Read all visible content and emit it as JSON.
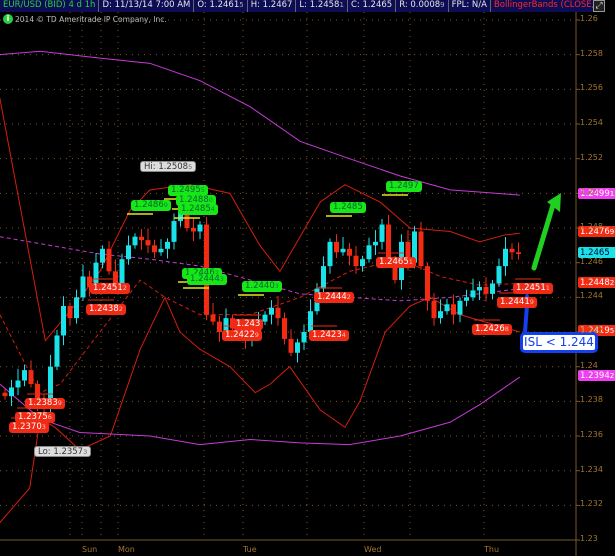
{
  "header": {
    "symbol": "EUR/USD (BID) 4 d 1h",
    "date": "D: 11/13/14 7:00 AM",
    "open": "O: 1.2461",
    "open_sub": "5",
    "high": "H: 1.2467",
    "low": "L: 1.2458",
    "low_sub": "1",
    "close": "C: 1.2465",
    "range": "R: 0.0008",
    "range_sub": "9",
    "fpl": "FPL: N/A",
    "study": "BollingerBands (CLOSE, 0,..."
  },
  "copyright": "2014 © TD Ameritrade IP Company, Inc.",
  "info_icon": "i",
  "expand_icon": "⤢",
  "colors": {
    "up": "#19e3e8",
    "down": "#f52a12",
    "band_red": "#d41e0e",
    "band_magenta": "#c63ad6",
    "grid": "#7a5a26"
  },
  "y_axis": {
    "min": 1.23,
    "max": 1.26,
    "ticks": [
      "1.26",
      "1.258",
      "1.256",
      "1.254",
      "1.252",
      "1.25",
      "1.248",
      "1.246",
      "1.244",
      "1.242",
      "1.24",
      "1.238",
      "1.236",
      "1.234",
      "1.232",
      "1.23"
    ]
  },
  "x_axis": {
    "days": [
      "Sun",
      "Mon",
      "Tue",
      "Wed",
      "Thu"
    ]
  },
  "chart_data": {
    "type": "candlestick",
    "closes": [
      1.2383,
      1.2388,
      1.2392,
      1.2398,
      1.239,
      1.238,
      1.2376,
      1.24,
      1.2418,
      1.2435,
      1.2428,
      1.244,
      1.2452,
      1.2446,
      1.246,
      1.2468,
      1.2455,
      1.2448,
      1.2462,
      1.247,
      1.2475,
      1.2473,
      1.247,
      1.2466,
      1.2468,
      1.2472,
      1.2484,
      1.2496,
      1.248,
      1.2478,
      1.2482,
      1.243,
      1.2426,
      1.242,
      1.2428,
      1.2422,
      1.2418,
      1.2416,
      1.242,
      1.2426,
      1.243,
      1.2434,
      1.2428,
      1.2416,
      1.2408,
      1.2414,
      1.242,
      1.2432,
      1.2445,
      1.2458,
      1.2472,
      1.2466,
      1.2468,
      1.2464,
      1.2458,
      1.2462,
      1.247,
      1.2472,
      1.2482,
      1.2462,
      1.245,
      1.2472,
      1.246,
      1.2478,
      1.2458,
      1.2438,
      1.2428,
      1.2432,
      1.2436,
      1.243,
      1.2438,
      1.244,
      1.2444,
      1.2446,
      1.2442,
      1.2448,
      1.2458,
      1.2468,
      1.2466,
      1.2465
    ],
    "bands": [
      {
        "name": "upper-red",
        "color": "#d41e0e",
        "dash": false,
        "points": [
          [
            -0.8,
            1.2555
          ],
          [
            6.2,
            1.2415
          ],
          [
            10,
            1.2432
          ],
          [
            14.6,
            1.2455
          ],
          [
            19.2,
            1.249
          ],
          [
            22.3,
            1.2502
          ],
          [
            28.5,
            1.2505
          ],
          [
            34.6,
            1.25
          ],
          [
            39.2,
            1.247
          ],
          [
            42.3,
            1.2455
          ],
          [
            45.4,
            1.2475
          ],
          [
            48.5,
            1.2495
          ],
          [
            52.3,
            1.2505
          ],
          [
            57.7,
            1.2495
          ],
          [
            62.3,
            1.248
          ],
          [
            68.5,
            1.2478
          ],
          [
            73,
            1.2472
          ],
          [
            76.9,
            1.2476
          ],
          [
            79.2,
            1.2477
          ]
        ]
      },
      {
        "name": "lower-red",
        "color": "#d41e0e",
        "dash": false,
        "points": [
          [
            -0.8,
            1.231
          ],
          [
            3.8,
            1.233
          ],
          [
            5.4,
            1.237
          ],
          [
            7.7,
            1.2365
          ],
          [
            11.5,
            1.2352
          ],
          [
            16.2,
            1.236
          ],
          [
            20.8,
            1.241
          ],
          [
            24.6,
            1.244
          ],
          [
            26.9,
            1.242
          ],
          [
            30,
            1.241
          ],
          [
            34.6,
            1.24
          ],
          [
            38.5,
            1.2385
          ],
          [
            40.8,
            1.239
          ],
          [
            43.8,
            1.24
          ],
          [
            48.5,
            1.2375
          ],
          [
            52.3,
            1.2365
          ],
          [
            54.6,
            1.238
          ],
          [
            58.5,
            1.242
          ],
          [
            62.3,
            1.2435
          ],
          [
            65.4,
            1.244
          ],
          [
            70,
            1.243
          ],
          [
            74.6,
            1.2425
          ],
          [
            79.2,
            1.242
          ]
        ]
      },
      {
        "name": "middle-red",
        "color": "#d41e0e",
        "dash": true,
        "points": [
          [
            -0.8,
            1.243
          ],
          [
            5.4,
            1.2385
          ],
          [
            8.5,
            1.239
          ],
          [
            14.6,
            1.242
          ],
          [
            20.8,
            1.245
          ],
          [
            24.6,
            1.244
          ],
          [
            30,
            1.243
          ],
          [
            37.7,
            1.243
          ],
          [
            45.4,
            1.244
          ],
          [
            53,
            1.2455
          ],
          [
            60.8,
            1.2462
          ],
          [
            67,
            1.2452
          ],
          [
            73,
            1.2447
          ],
          [
            79.2,
            1.2448
          ]
        ]
      },
      {
        "name": "upper-magenta",
        "color": "#c63ad6",
        "dash": false,
        "points": [
          [
            -0.8,
            1.258
          ],
          [
            5.4,
            1.2582
          ],
          [
            14.6,
            1.2578
          ],
          [
            22.3,
            1.2575
          ],
          [
            30,
            1.2565
          ],
          [
            37.7,
            1.255
          ],
          [
            45.4,
            1.253
          ],
          [
            53,
            1.252
          ],
          [
            60.8,
            1.251
          ],
          [
            68.5,
            1.2502
          ],
          [
            79.2,
            1.2499
          ]
        ]
      },
      {
        "name": "lower-magenta",
        "color": "#c63ad6",
        "dash": false,
        "points": [
          [
            -0.8,
            1.239
          ],
          [
            5.4,
            1.237
          ],
          [
            11.5,
            1.2362
          ],
          [
            22.3,
            1.236
          ],
          [
            30,
            1.2355
          ],
          [
            37.7,
            1.2358
          ],
          [
            45.4,
            1.2356
          ],
          [
            53,
            1.2355
          ],
          [
            60.8,
            1.236
          ],
          [
            68.5,
            1.2368
          ],
          [
            73,
            1.2378
          ],
          [
            79.2,
            1.2394
          ]
        ]
      },
      {
        "name": "middle-magenta",
        "color": "#c63ad6",
        "dash": true,
        "points": [
          [
            -0.8,
            1.2475
          ],
          [
            6.9,
            1.247
          ],
          [
            14.6,
            1.2465
          ],
          [
            22.3,
            1.2462
          ],
          [
            30,
            1.2458
          ],
          [
            37.7,
            1.245
          ],
          [
            45.4,
            1.2442
          ],
          [
            53,
            1.244
          ],
          [
            60.8,
            1.2438
          ],
          [
            68.5,
            1.244
          ],
          [
            79.2,
            1.2445
          ]
        ]
      }
    ],
    "hi_label": {
      "t": "Hi: 1.2508",
      "s": "5"
    },
    "lo_label": {
      "t": "Lo: 1.2357",
      "s": "3"
    },
    "green_labels": [
      {
        "t": "1.2495",
        "s": "5"
      },
      {
        "t": "1.2488",
        "s": "0"
      },
      {
        "t": "1.2485",
        "s": "4"
      },
      {
        "t": "1.2486",
        "s": "9"
      },
      {
        "t": "1.2446",
        "s": "2"
      },
      {
        "t": "1.2444",
        "s": "3"
      },
      {
        "t": "1.2440",
        "s": "3"
      },
      {
        "t": "1.2485",
        "s": ""
      },
      {
        "t": "1.2497",
        "s": ""
      }
    ],
    "red_labels": [
      {
        "t": "1.2451",
        "s": "2"
      },
      {
        "t": "1.2438",
        "s": "2"
      },
      {
        "t": "1.243",
        "s": ""
      },
      {
        "t": "1.2422",
        "s": "9"
      },
      {
        "t": "1.2383",
        "s": "9"
      },
      {
        "t": "1.2375",
        "s": "6"
      },
      {
        "t": "1.2370",
        "s": "3"
      },
      {
        "t": "1.2444",
        "s": "2"
      },
      {
        "t": "1.2423",
        "s": "4"
      },
      {
        "t": "1.2465",
        "s": "1"
      },
      {
        "t": "1.2451",
        "s": "1"
      },
      {
        "t": "1.2441",
        "s": "9"
      },
      {
        "t": "1.2426",
        "s": "8"
      }
    ],
    "axis_tags": [
      {
        "t": "1.2499",
        "s": "1",
        "c": "#ef3ff0"
      },
      {
        "t": "1.2476",
        "s": "9",
        "c": "#f52a12"
      },
      {
        "t": "1.2465",
        "s": "",
        "c": "#19e3e8"
      },
      {
        "t": "1.2448",
        "s": "2",
        "c": "#f52a12"
      },
      {
        "t": "1.2419",
        "s": "5",
        "c": "#f52a12"
      },
      {
        "t": "1.2394",
        "s": "2",
        "c": "#ef3ff0"
      }
    ]
  },
  "annotation": {
    "text": "ISL < 1.244"
  }
}
